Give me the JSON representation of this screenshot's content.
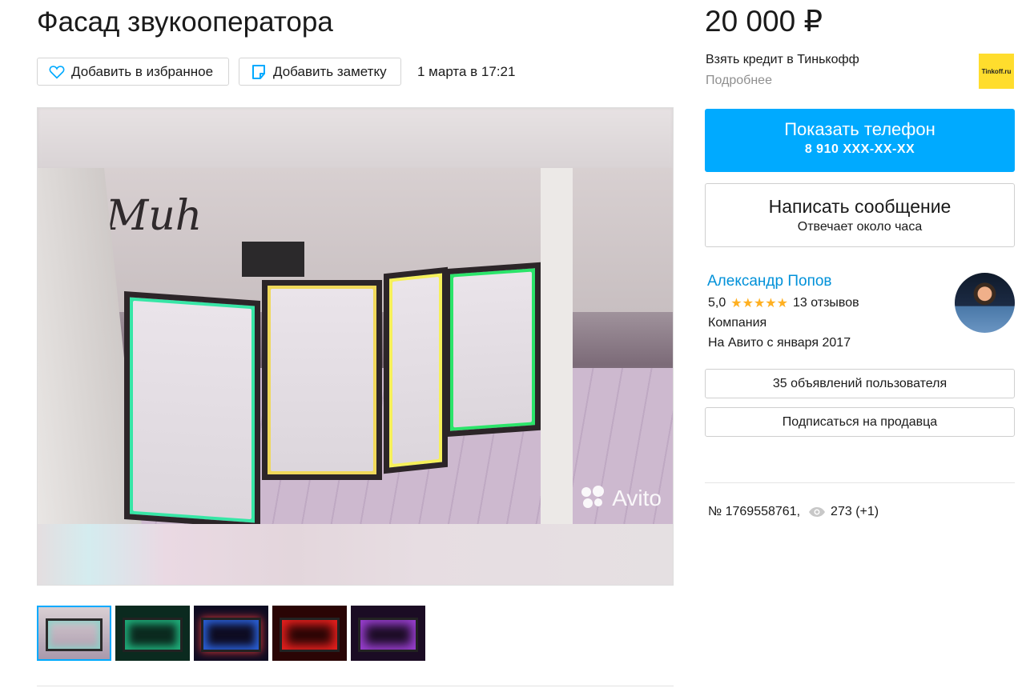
{
  "listing": {
    "title": "Фасад звукооператора",
    "favorite_label": "Добавить в избранное",
    "note_label": "Добавить заметку",
    "date": "1 марта в 17:21",
    "watermark": "Avito",
    "photo_caption_text": "Muh"
  },
  "sidebar": {
    "price": "20 000 ₽",
    "credit": {
      "title": "Взять кредит в Тинькофф",
      "more": "Подробнее",
      "logo_text": "Tinkoff.ru"
    },
    "phone_button": {
      "label": "Показать телефон",
      "number": "8 910 XXX-XX-XX"
    },
    "message_button": {
      "label": "Написать сообщение",
      "sublabel": "Отвечает около часа"
    },
    "seller": {
      "name": "Александр Попов",
      "rating": "5,0",
      "stars": "★★★★★",
      "reviews": "13 отзывов",
      "type": "Компания",
      "since": "На Авито с января 2017"
    },
    "user_ads_button": "35 объявлений пользователя",
    "subscribe_button": "Подписаться на продавца",
    "ad_number": "№ 1769558761,",
    "views": "273 (+1)"
  },
  "thumbnails": [
    {
      "name": "thumb-1",
      "color": "#8fd1c8"
    },
    {
      "name": "thumb-2",
      "color": "#1fae7a"
    },
    {
      "name": "thumb-3",
      "color": "#2a5fd6"
    },
    {
      "name": "thumb-4",
      "color": "#e8201e"
    },
    {
      "name": "thumb-5",
      "color": "#9a3fd1"
    }
  ],
  "colors": {
    "accent": "#00aaff",
    "link": "#0091d9",
    "star": "#ffb021",
    "tinkoff_yellow": "#ffdd2d"
  }
}
